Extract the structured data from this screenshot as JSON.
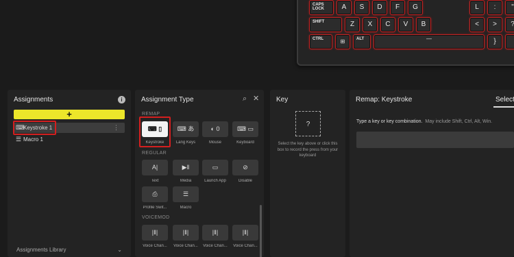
{
  "keyboard": {
    "caps_lock": "CAPS\nLOCK",
    "shift": "SHIFT",
    "ctrl": "CTRL",
    "alt": "ALT",
    "key_a": "A",
    "key_s": "S",
    "key_d": "D",
    "key_f": "F",
    "key_g": "G",
    "key_z": "Z",
    "key_x": "X",
    "key_c": "C",
    "key_v": "V",
    "key_b": "B",
    "key_l": "L",
    "key_comma": "<",
    "key_period": ">",
    "key_slash": "?",
    "key_semicolon": ":",
    "key_quote": "\"",
    "key_brace": "}",
    "backlight_color": "#c42424"
  },
  "assignments": {
    "title": "Assignments",
    "info_icon": "info-icon",
    "add_label": "+",
    "items": [
      {
        "label": "Keystroke 1",
        "icon": "keystroke-icon"
      },
      {
        "label": "Macro 1",
        "icon": "macro-list-icon"
      }
    ],
    "more_icon": "⋮",
    "library_label": "Assignments Library",
    "accent": "#ece62a"
  },
  "assignment_type": {
    "title": "Assignment Type",
    "sections": {
      "remap": "REMAP",
      "regular": "REGULAR",
      "voicemod": "VOICEMOD"
    },
    "remap_tiles": [
      {
        "label": "Keystroke",
        "glyph": "⌨︎ ▯",
        "selected": true
      },
      {
        "label": "Lang Keys",
        "glyph": "⌨︎ あ",
        "selected": false
      },
      {
        "label": "Mouse",
        "glyph": "◐ 0",
        "selected": false
      },
      {
        "label": "Keyboard",
        "glyph": "⌨︎ ▭",
        "selected": false
      }
    ],
    "regular_tiles": [
      {
        "label": "Text",
        "glyph": "A|"
      },
      {
        "label": "Media",
        "glyph": "▶‖"
      },
      {
        "label": "Launch App",
        "glyph": "▭"
      },
      {
        "label": "Disable",
        "glyph": "⊘"
      },
      {
        "label": "Profile Swit...",
        "glyph": "⎙"
      },
      {
        "label": "Macro",
        "glyph": "☰"
      }
    ],
    "voicemod_tiles": [
      {
        "label": "Voice Chan...",
        "glyph": "|‖|"
      },
      {
        "label": "Voice Chan...",
        "glyph": "|‖|"
      },
      {
        "label": "Voice Chan...",
        "glyph": "|‖|"
      },
      {
        "label": "Voice Chan...",
        "glyph": "|‖|"
      }
    ]
  },
  "key_panel": {
    "title": "Key",
    "placeholder": "?",
    "description": "Select the key above or click this box to record the press from your keyboard"
  },
  "remap_panel": {
    "title": "Remap: Keystroke",
    "select_tab": "Select",
    "hint": "Type a key or key combination.",
    "hint_sub": "May include Shift, Ctrl, Alt, Win."
  }
}
